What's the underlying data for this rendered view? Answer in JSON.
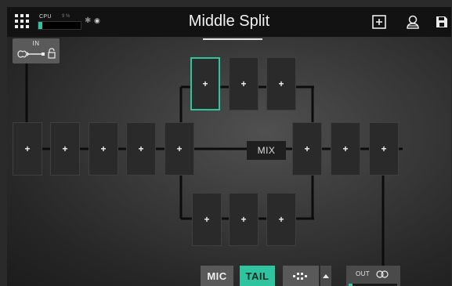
{
  "header": {
    "title": "Middle Split",
    "cpu_label": "CPU",
    "cpu_percent": "9 %",
    "cpu_load": 0.09,
    "icons": [
      "grid-icon",
      "bluetooth-icon",
      "wifi-icon",
      "add-box-icon",
      "user-icon",
      "save-icon"
    ]
  },
  "input": {
    "label": "IN",
    "icons": [
      "guitar-icon",
      "lock-icon"
    ]
  },
  "mix": {
    "label": "MIX"
  },
  "slots": {
    "add_symbol": "+"
  },
  "bottom": {
    "mic_label": "MIC",
    "tail_label": "TAIL",
    "out_label": "OUT",
    "output_level": 0.08
  },
  "colors": {
    "accent": "#2ec4a0",
    "topbar": "#121212"
  }
}
